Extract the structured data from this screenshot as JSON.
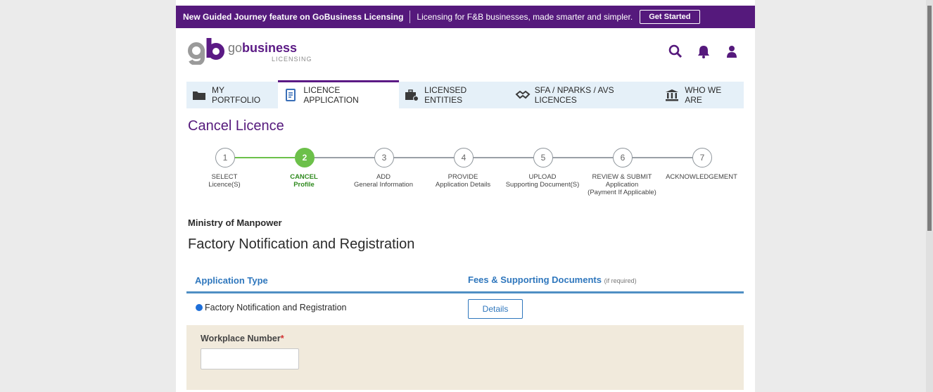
{
  "banner": {
    "headline": "New Guided Journey feature on GoBusiness Licensing",
    "subtext": "Licensing for F&B businesses, made smarter and simpler.",
    "cta": "Get Started"
  },
  "logo": {
    "go": "go",
    "business": "business",
    "sub": "LICENSING"
  },
  "icons": [
    "search-icon",
    "bell-icon",
    "user-icon"
  ],
  "nav": {
    "items": [
      {
        "label": "MY PORTFOLIO",
        "icon": "folder-icon"
      },
      {
        "label": "LICENCE APPLICATION",
        "icon": "document-icon"
      },
      {
        "label": "LICENSED ENTITIES",
        "icon": "briefcase-icon"
      },
      {
        "label": "SFA / NPARKS / AVS LICENCES",
        "icon": "handshake-icon"
      },
      {
        "label": "WHO WE ARE",
        "icon": "institution-icon"
      }
    ]
  },
  "page_title": "Cancel Licence",
  "stepper": {
    "current": 2,
    "steps": [
      {
        "n": "1",
        "title": "SELECT",
        "sub": "Licence(S)",
        "sub2": ""
      },
      {
        "n": "2",
        "title": "CANCEL",
        "sub": "Profile",
        "sub2": ""
      },
      {
        "n": "3",
        "title": "ADD",
        "sub": "General Information",
        "sub2": ""
      },
      {
        "n": "4",
        "title": "PROVIDE",
        "sub": "Application Details",
        "sub2": ""
      },
      {
        "n": "5",
        "title": "UPLOAD",
        "sub": "Supporting Document(S)",
        "sub2": ""
      },
      {
        "n": "6",
        "title": "REVIEW & SUBMIT",
        "sub": "Application",
        "sub2": "(Payment If Applicable)"
      },
      {
        "n": "7",
        "title": "ACKNOWLEDGEMENT",
        "sub": "",
        "sub2": ""
      }
    ]
  },
  "agency": "Ministry of Manpower",
  "licence_name": "Factory Notification and Registration",
  "table": {
    "col1": "Application Type",
    "col2": "Fees & Supporting Documents",
    "col2_note": "(if required)",
    "row_label": "Factory Notification and Registration",
    "details_button": "Details"
  },
  "form": {
    "label": "Workplace Number",
    "required_mark": "*",
    "value": ""
  },
  "colors": {
    "brand_purple": "#55197c",
    "step_active": "#6cc04a",
    "link_blue": "#2f77bd",
    "nav_bg": "#e5f0f8",
    "form_bg": "#f1eadc"
  }
}
